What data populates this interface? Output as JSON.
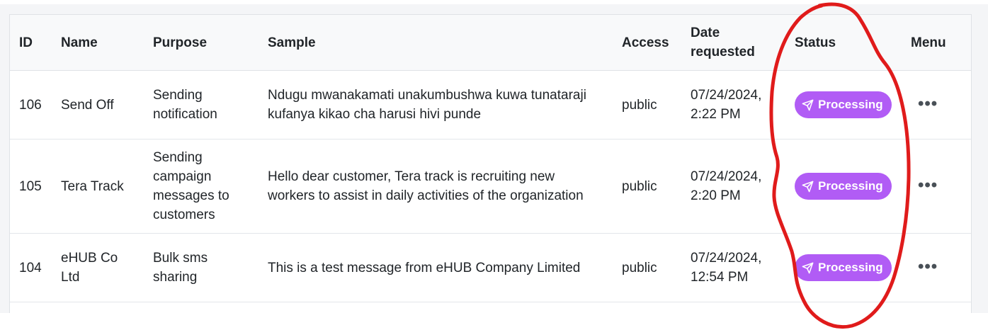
{
  "table": {
    "headers": {
      "id": "ID",
      "name": "Name",
      "purpose": "Purpose",
      "sample": "Sample",
      "access": "Access",
      "date": "Date requested",
      "status": "Status",
      "menu": "Menu"
    },
    "rows": [
      {
        "id": "106",
        "name": "Send Off",
        "purpose": "Sending notification",
        "sample": "Ndugu mwanakamati unakumbushwa kuwa tunataraji kufanya kikao cha harusi hivi punde",
        "access": "public",
        "date": "07/24/2024, 2:22 PM",
        "status": "Processing",
        "menu": "•••"
      },
      {
        "id": "105",
        "name": "Tera Track",
        "purpose": "Sending campaign messages to customers",
        "sample": "Hello dear customer, Tera track is recruiting new workers to assist in daily activities of the organization",
        "access": "public",
        "date": "07/24/2024, 2:20 PM",
        "status": "Processing",
        "menu": "•••"
      },
      {
        "id": "104",
        "name": "eHUB Co Ltd",
        "purpose": "Bulk sms sharing",
        "sample": "This is a test message from eHUB Company Limited",
        "access": "public",
        "date": "07/24/2024, 12:54 PM",
        "status": "Processing",
        "menu": "•••"
      }
    ]
  },
  "colors": {
    "status_badge": "#b15cf5",
    "annotation_stroke": "#e01b1b",
    "header_bg": "#f8f9fa"
  },
  "icons": {
    "status": "send-icon",
    "menu": "more-horizontal-icon"
  }
}
